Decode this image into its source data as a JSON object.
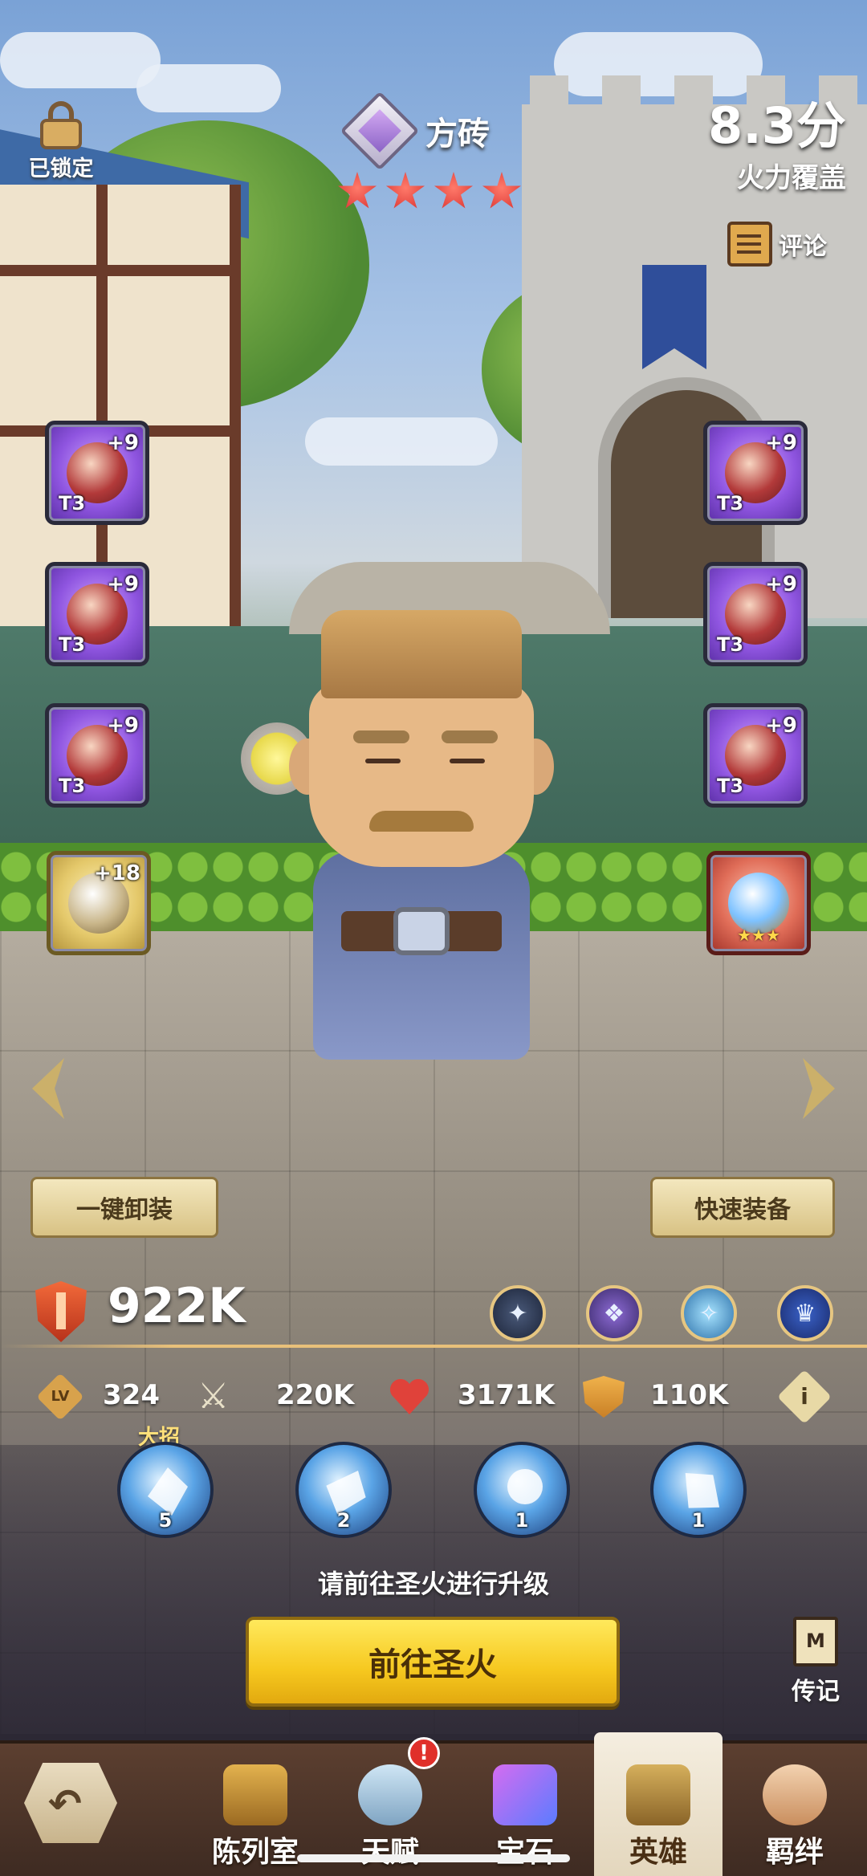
{
  "header": {
    "lock_label": "已锁定",
    "hero_name": "方砖",
    "star_count": 4,
    "score_value": "8.3分",
    "score_label": "火力覆盖",
    "comment_label": "评论"
  },
  "equipment": {
    "left": [
      {
        "plus": "+9",
        "tier": "T3",
        "quality": "purple",
        "icon": "staff-icon"
      },
      {
        "plus": "+9",
        "tier": "T3",
        "quality": "purple",
        "icon": "hood-icon"
      },
      {
        "plus": "+9",
        "tier": "T3",
        "quality": "purple",
        "icon": "ring-icon"
      },
      {
        "plus": "+18",
        "tier": "",
        "quality": "gold",
        "icon": "relic-icon"
      }
    ],
    "right": [
      {
        "plus": "+9",
        "tier": "T3",
        "quality": "purple",
        "icon": "armor-icon"
      },
      {
        "plus": "+9",
        "tier": "T3",
        "quality": "purple",
        "icon": "bracer-icon"
      },
      {
        "plus": "+9",
        "tier": "T3",
        "quality": "purple",
        "icon": "necklace-icon"
      },
      {
        "plus": "",
        "tier": "",
        "quality": "red",
        "stars": 3,
        "stars_text": "★★★",
        "icon": "orb-icon"
      }
    ]
  },
  "actions": {
    "unequip_all": "一键卸装",
    "quick_equip": "快速装备"
  },
  "power": {
    "value": "922K",
    "runes": [
      "sword-rune-icon",
      "book-rune-icon",
      "crystal-rune-icon",
      "helmet-rune-icon"
    ]
  },
  "stats": {
    "level_badge": "LV",
    "level": "324",
    "attack": "220K",
    "hp": "3171K",
    "defense": "110K",
    "info_icon": "i"
  },
  "skills": {
    "ultimate_label": "大招",
    "items": [
      {
        "icon": "ultimate-skill-icon",
        "level": "5"
      },
      {
        "icon": "ice-shard-skill-icon",
        "level": "2"
      },
      {
        "icon": "spirit-skill-icon",
        "level": "1"
      },
      {
        "icon": "frost-wave-skill-icon",
        "level": "1"
      }
    ]
  },
  "upgrade": {
    "hint": "请前往圣火进行升级",
    "button": "前往圣火"
  },
  "biography": {
    "label": "传记"
  },
  "bottom_nav": {
    "back_icon": "back-arrow-icon",
    "tabs": [
      {
        "label": "陈列室",
        "icon": "showroom-icon",
        "badge": ""
      },
      {
        "label": "天赋",
        "icon": "talent-icon",
        "badge": "!"
      },
      {
        "label": "宝石",
        "icon": "gem-icon",
        "badge": ""
      },
      {
        "label": "英雄",
        "icon": "hero-icon",
        "badge": "",
        "active": true
      },
      {
        "label": "羁绊",
        "icon": "bond-icon",
        "badge": ""
      }
    ]
  },
  "colors": {
    "star": "#d42a2a",
    "primary_button": "#f6c81f",
    "epic": "#8f55e0",
    "legendary": "#e4c86a",
    "mythic": "#e06d58",
    "alert_badge": "#e0302a"
  }
}
